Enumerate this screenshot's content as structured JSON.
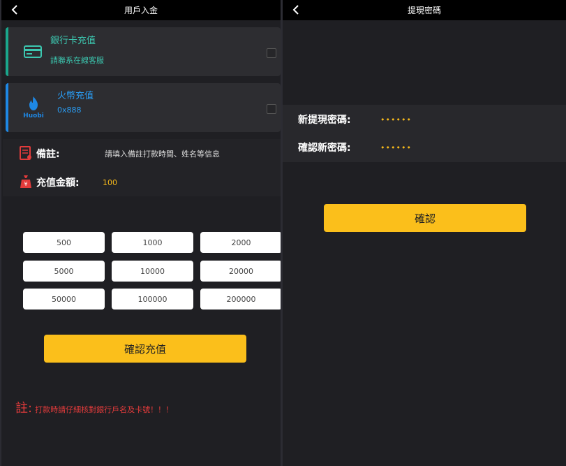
{
  "deposit": {
    "title": "用戶入金",
    "methods": [
      {
        "name": "銀行卡充值",
        "sub": "請聯系在線客服",
        "icon": "bank-card-icon",
        "accent": "#1aa68c",
        "name_color": "#3cc7b0",
        "sub_color": "#3cc7b0"
      },
      {
        "name": "火幣充值",
        "sub": "0x888",
        "icon": "huobi-logo-icon",
        "logo_text": "Huobi",
        "accent": "#1e88e5",
        "name_color": "#2a9df4",
        "sub_color": "#2a9df4"
      }
    ],
    "remark_label": "備註:",
    "remark_placeholder": "請填入備註打款時間、姓名等信息",
    "amount_label": "充值金額:",
    "amount_value": "100",
    "amounts": [
      "500",
      "1000",
      "2000",
      "5000",
      "10000",
      "20000",
      "50000",
      "100000",
      "200000"
    ],
    "confirm_label": "確認充值",
    "note_prefix": "註:",
    "note_text": "打款時請仔細核對銀行戶名及卡號！！！",
    "colors": {
      "yellow": "#fbbf1b",
      "warning": "#e23b3b",
      "amount": "#f5b81b"
    }
  },
  "password": {
    "title": "提現密碼",
    "new_label": "新提現密碼:",
    "new_value": "••••••",
    "confirm_new_label": "確認新密碼:",
    "confirm_new_value": "••••••",
    "confirm_label": "確認"
  }
}
